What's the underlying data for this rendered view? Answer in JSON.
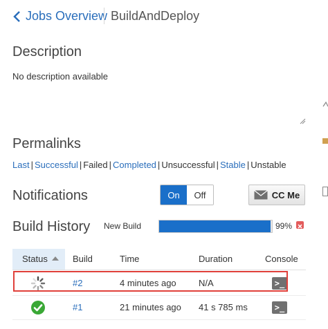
{
  "header": {
    "back_label": "Jobs Overview",
    "current_job": "BuildAndDeploy"
  },
  "description": {
    "title": "Description",
    "text": "No description available"
  },
  "permalinks": {
    "title": "Permalinks",
    "items": [
      {
        "label": "Last",
        "link": true
      },
      {
        "label": "Successful",
        "link": true
      },
      {
        "label": "Failed",
        "link": false
      },
      {
        "label": "Completed",
        "link": true
      },
      {
        "label": "Unsuccessful",
        "link": false
      },
      {
        "label": "Stable",
        "link": true
      },
      {
        "label": "Unstable",
        "link": false
      }
    ]
  },
  "notifications": {
    "title": "Notifications",
    "on_label": "On",
    "off_label": "Off",
    "selected": "On",
    "ccme_label": "CC Me"
  },
  "build_history": {
    "title": "Build History",
    "new_build_label": "New Build",
    "progress_percent": 99,
    "progress_label": "99%",
    "columns": {
      "status": "Status",
      "build": "Build",
      "time": "Time",
      "duration": "Duration",
      "console": "Console"
    },
    "rows": [
      {
        "status": "in-progress",
        "build": "#2",
        "time": "4 minutes ago",
        "duration": "N/A",
        "console_icon": "terminal-icon"
      },
      {
        "status": "success",
        "build": "#1",
        "time": "21 minutes ago",
        "duration": "41 s 785 ms",
        "console_icon": "terminal-icon"
      }
    ]
  },
  "colors": {
    "link": "#2a6ebb",
    "accent": "#1a6fc9",
    "highlight_border": "#e0403a",
    "success": "#3aa836"
  }
}
